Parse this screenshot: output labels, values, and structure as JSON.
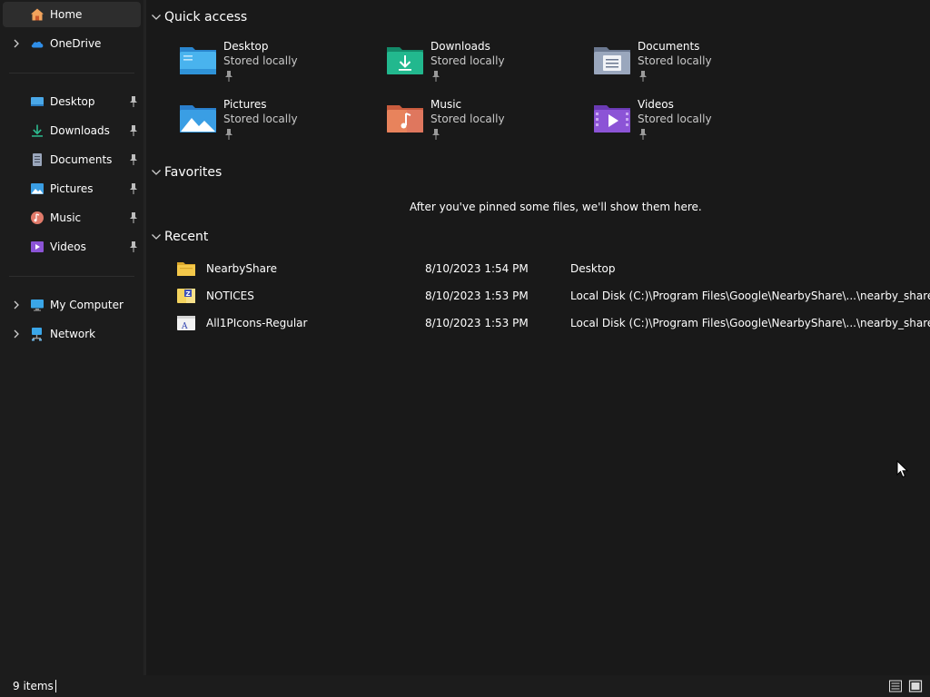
{
  "sidebar": {
    "home": {
      "label": "Home",
      "icon": "home-icon"
    },
    "onedrive": {
      "label": "OneDrive",
      "icon": "onedrive-cloud-icon"
    },
    "pinned": [
      {
        "label": "Desktop",
        "icon": "desktop-folder-icon",
        "pinned": true
      },
      {
        "label": "Downloads",
        "icon": "downloads-icon",
        "pinned": true
      },
      {
        "label": "Documents",
        "icon": "documents-icon",
        "pinned": true
      },
      {
        "label": "Pictures",
        "icon": "pictures-icon",
        "pinned": true
      },
      {
        "label": "Music",
        "icon": "music-icon",
        "pinned": true
      },
      {
        "label": "Videos",
        "icon": "videos-icon",
        "pinned": true
      }
    ],
    "my_computer": {
      "label": "My Computer",
      "icon": "computer-icon"
    },
    "network": {
      "label": "Network",
      "icon": "network-icon"
    }
  },
  "main": {
    "quick_access": {
      "title": "Quick access",
      "items": [
        {
          "name": "Desktop",
          "status": "Stored locally",
          "icon": "desktop-folder-icon",
          "color": "#3ea6e8"
        },
        {
          "name": "Downloads",
          "status": "Stored locally",
          "icon": "downloads-folder-icon",
          "color": "#1fb58c"
        },
        {
          "name": "Documents",
          "status": "Stored locally",
          "icon": "documents-folder-icon",
          "color": "#8e9bb3"
        },
        {
          "name": "Pictures",
          "status": "Stored locally",
          "icon": "pictures-folder-icon",
          "color": "#3a9ee4"
        },
        {
          "name": "Music",
          "status": "Stored locally",
          "icon": "music-folder-icon",
          "color": "#e8835c"
        },
        {
          "name": "Videos",
          "status": "Stored locally",
          "icon": "videos-folder-icon",
          "color": "#8c54d6"
        }
      ]
    },
    "favorites": {
      "title": "Favorites",
      "empty_message": "After you've pinned some files, we'll show them here."
    },
    "recent": {
      "title": "Recent",
      "items": [
        {
          "name": "NearbyShare",
          "date": "8/10/2023 1:54 PM",
          "location": "Desktop",
          "icon": "folder-icon"
        },
        {
          "name": "NOTICES",
          "date": "8/10/2023 1:53 PM",
          "location": "Local Disk (C:)\\Program Files\\Google\\NearbyShare\\...\\nearby_share.assets",
          "icon": "zip-archive-icon"
        },
        {
          "name": "All1PIcons-Regular",
          "date": "8/10/2023 1:53 PM",
          "location": "Local Disk (C:)\\Program Files\\Google\\NearbyShare\\...\\nearby_share.assets",
          "icon": "font-file-icon"
        }
      ]
    }
  },
  "statusbar": {
    "item_count": "9 items",
    "view_buttons": [
      "details-view-icon",
      "tiles-view-icon"
    ]
  }
}
